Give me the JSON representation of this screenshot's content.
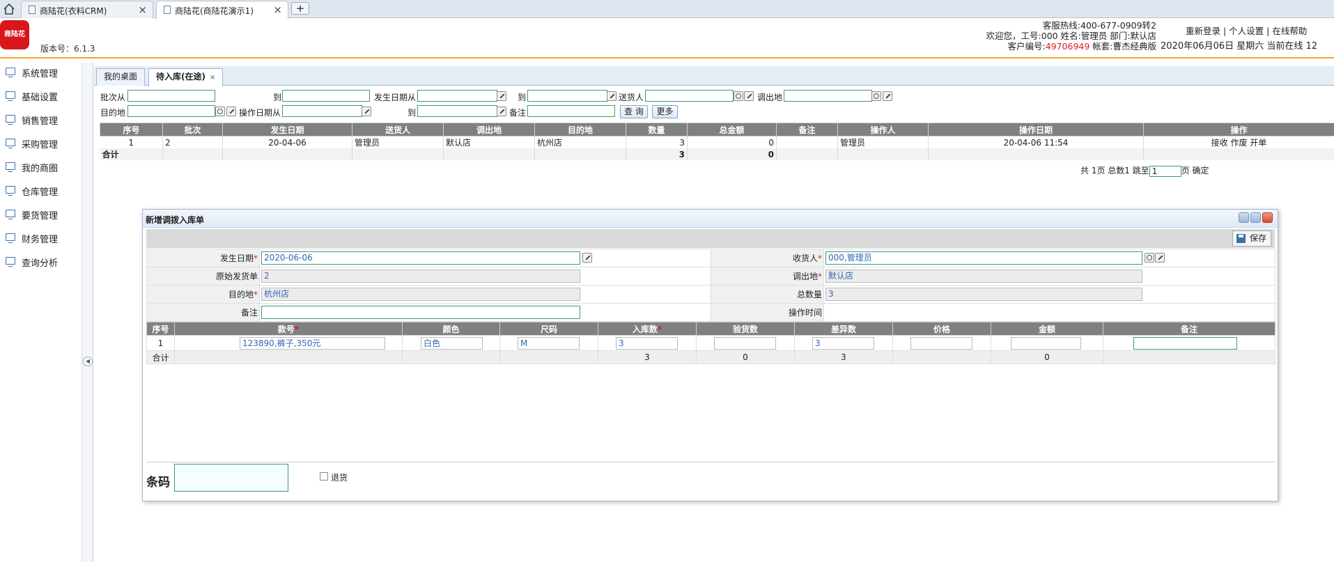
{
  "browser": {
    "tabs": [
      {
        "title": "商陆花(衣料CRM)"
      },
      {
        "title": "商陆花(商陆花演示1)"
      }
    ],
    "new_tab": "+"
  },
  "header": {
    "logo_text": "商陆花",
    "version": "版本号：6.1.3",
    "hotline": "客服热线:400-677-0909转2",
    "welcome": "欢迎您，工号:000 姓名:管理员 部门:默认店",
    "customer_prefix": "客户编号:",
    "customer_no": "49706949",
    "account": " 帐套:曹杰经典版",
    "links": "重新登录 | 个人设置 | 在线帮助",
    "datetime": "2020年06月06日 星期六 当前在线 12"
  },
  "sidebar": {
    "items": [
      "系统管理",
      "基础设置",
      "销售管理",
      "采购管理",
      "我的商圈",
      "仓库管理",
      "要货管理",
      "财务管理",
      "查询分析"
    ]
  },
  "content_tabs": [
    {
      "label": "我的桌面"
    },
    {
      "label": "待入库(在途)",
      "close": "×"
    }
  ],
  "filters": {
    "batch_from": "批次从",
    "to": "到",
    "date_from": "发生日期从",
    "to2": "到",
    "sender": "送货人",
    "out_store": "调出地",
    "dest": "目的地",
    "op_date_from": "操作日期从",
    "to3": "到",
    "remark": "备注",
    "query_btn": "查 询",
    "more_btn": "更多"
  },
  "grid": {
    "columns": [
      "序号",
      "批次",
      "发生日期",
      "送货人",
      "调出地",
      "目的地",
      "数量",
      "总金额",
      "备注",
      "操作人",
      "操作日期",
      "操作"
    ],
    "rows": [
      {
        "no": "1",
        "batch": "2",
        "date": "20-04-06",
        "sender": "管理员",
        "from": "默认店",
        "to": "杭州店",
        "qty": "3",
        "amount": "0",
        "remark": "",
        "operator": "管理员",
        "op_date": "20-04-06 11:54",
        "actions": "接收 作废 开单"
      }
    ],
    "sum": {
      "label": "合计",
      "qty": "3",
      "amount": "0"
    }
  },
  "pager": {
    "text": "共 1页 总数1 跳至",
    "page": "1",
    "suffix": "页 确定"
  },
  "dialog": {
    "title": "新增调拨入库单",
    "save": "保存",
    "form": {
      "date_label": "发生日期",
      "date_value": "2020-06-06",
      "receiver_label": "收货人",
      "receiver_value": "000,管理员",
      "orig_label": "原始发货单",
      "orig_value": "2",
      "out_label": "调出地",
      "out_value": "默认店",
      "dest_label": "目的地",
      "dest_value": "杭州店",
      "total_label": "总数量",
      "total_value": "3",
      "remark_label": "备注",
      "optime_label": "操作时间",
      "req": "*"
    },
    "detail": {
      "columns": [
        "序号",
        "款号",
        "颜色",
        "尺码",
        "入库数",
        "验货数",
        "差异数",
        "价格",
        "金额",
        "备注"
      ],
      "row": {
        "no": "1",
        "sku": "123890,裤子,350元",
        "color": "白色",
        "size": "M",
        "in_qty": "3",
        "check_qty": "",
        "diff": "3"
      },
      "sum": {
        "label": "合计",
        "in_qty": "3",
        "check_qty": "0",
        "diff": "3",
        "amount": "0"
      }
    },
    "barcode_label": "条码",
    "return_label": "退货"
  }
}
